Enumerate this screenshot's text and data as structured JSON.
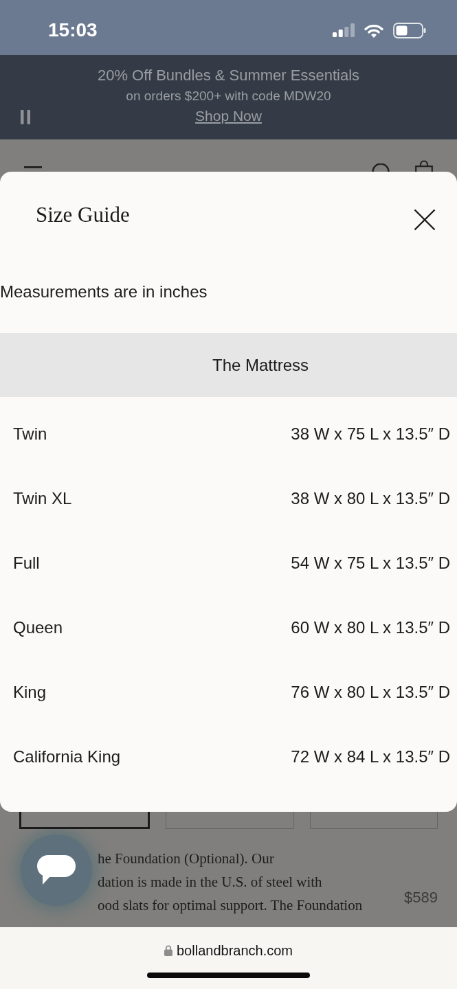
{
  "status_bar": {
    "time": "15:03"
  },
  "promo_banner": {
    "headline": "20% Off Bundles & Summer Essentials",
    "subline": "on orders $200+ with code MDW20",
    "link": "Shop Now"
  },
  "size_guide": {
    "title": "Size Guide",
    "note": "Measurements are in inches",
    "table": {
      "heading": "The Mattress",
      "rows": [
        {
          "size": "Twin",
          "dimensions": "38 W x 75 L x 13.5″ D"
        },
        {
          "size": "Twin XL",
          "dimensions": "38 W x 80 L x 13.5″ D"
        },
        {
          "size": "Full",
          "dimensions": "54 W x 75 L x 13.5″ D"
        },
        {
          "size": "Queen",
          "dimensions": "60 W x 80 L x 13.5″ D"
        },
        {
          "size": "King",
          "dimensions": "76 W x 80 L x 13.5″ D"
        },
        {
          "size": "California King",
          "dimensions": "72 W x 84 L x 13.5″ D"
        }
      ]
    }
  },
  "size_options": [
    {
      "selected": true
    },
    {
      "selected": false
    },
    {
      "selected": false
    }
  ],
  "foundation_addon": {
    "description_lines": [
      "he Foundation (Optional). Our",
      "dation is made in the U.S. of steel with",
      "ood slats for optimal support. The Foundation"
    ],
    "price": "$589"
  },
  "browser_bar": {
    "url": "bollandbranch.com"
  }
}
